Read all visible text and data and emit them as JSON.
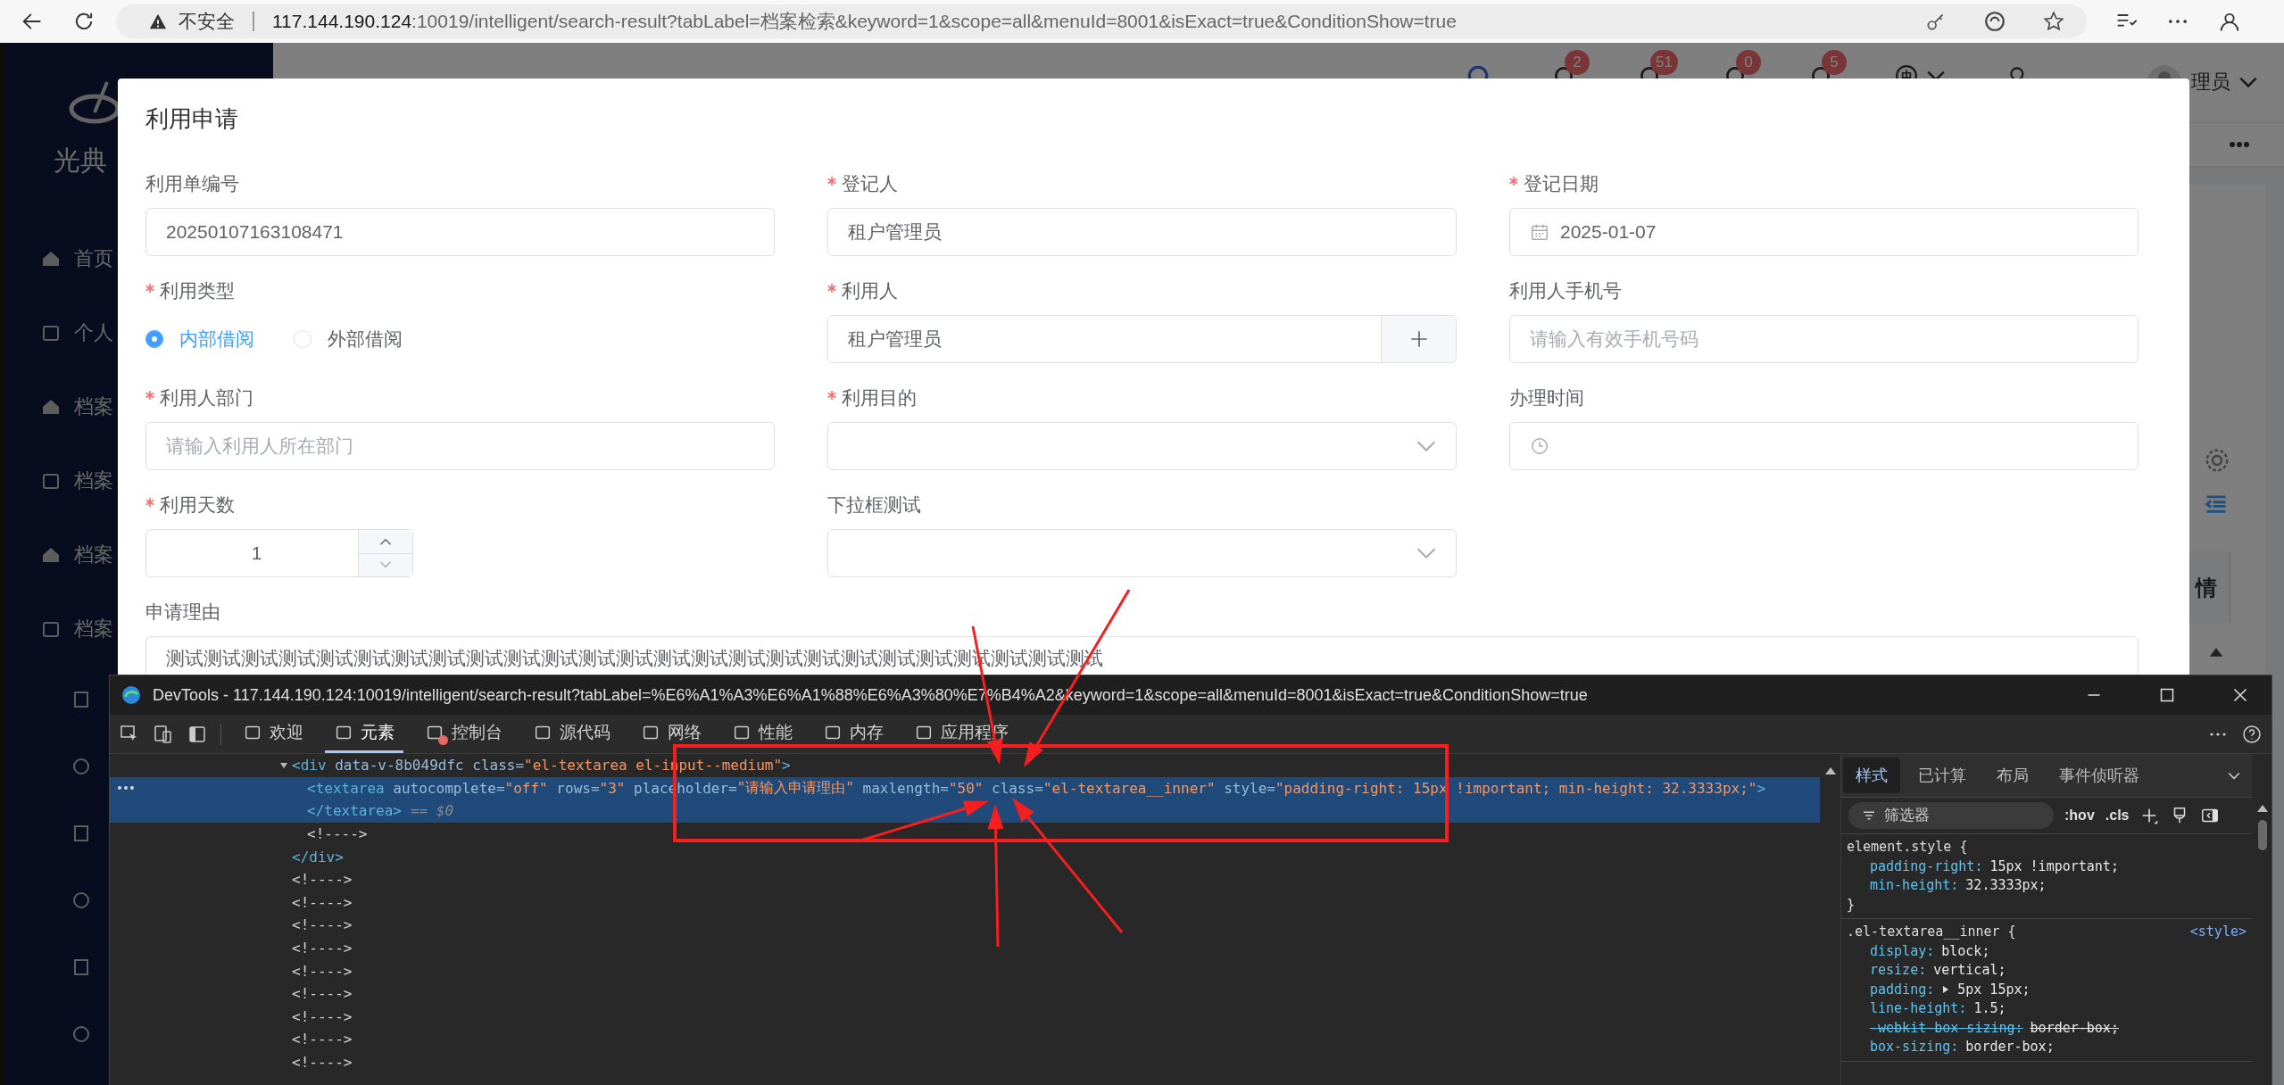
{
  "browser": {
    "security": "不安全",
    "url_host": "117.144.190.124",
    "url_rest": ":10019/intelligent/search-result?tabLabel=档案检索&keyword=1&scope=all&menuId=8001&isExact=true&ConditionShow=true"
  },
  "sidebar": {
    "brand": "光典",
    "items": [
      {
        "label": "首页"
      },
      {
        "label": "个人"
      },
      {
        "label": "档案"
      },
      {
        "label": "档案"
      },
      {
        "label": "档案"
      },
      {
        "label": "档案"
      }
    ]
  },
  "header": {
    "items": [
      {
        "badge": "2"
      },
      {
        "badge": "51"
      },
      {
        "badge": "0"
      },
      {
        "badge": "5"
      }
    ],
    "user": "理员"
  },
  "page": {
    "table_header": "情"
  },
  "dialog": {
    "title": "利用申请",
    "fields": [
      {
        "kind": "text",
        "label": "利用单编号",
        "required": false,
        "value": "20250107163108471"
      },
      {
        "kind": "text",
        "label": "登记人",
        "required": true,
        "value": "租户管理员"
      },
      {
        "kind": "date",
        "label": "登记日期",
        "required": true,
        "value": "2025-01-07"
      },
      {
        "kind": "radio",
        "label": "利用类型",
        "required": true,
        "options": [
          {
            "label": "内部借阅",
            "selected": true
          },
          {
            "label": "外部借阅",
            "selected": false
          }
        ]
      },
      {
        "kind": "picker",
        "label": "利用人",
        "required": true,
        "value": "租户管理员"
      },
      {
        "kind": "text",
        "label": "利用人手机号",
        "required": false,
        "placeholder": "请输入有效手机号码"
      },
      {
        "kind": "text",
        "label": "利用人部门",
        "required": true,
        "placeholder": "请输入利用人所在部门"
      },
      {
        "kind": "select",
        "label": "利用目的",
        "required": true
      },
      {
        "kind": "time",
        "label": "办理时间",
        "required": false
      },
      {
        "kind": "number",
        "label": "利用天数",
        "required": true,
        "value": "1"
      },
      {
        "kind": "select",
        "label": "下拉框测试",
        "required": false
      },
      {
        "kind": "textarea",
        "label": "申请理由",
        "required": false,
        "value": "测试测试测试测试测试测试测试测试测试测试测试测试测试测试测试测试测试测试测试测试测试测试测试测试测试"
      }
    ]
  },
  "devtools": {
    "title": "DevTools - 117.144.190.124:10019/intelligent/search-result?tabLabel=%E6%A1%A3%E6%A1%88%E6%A3%80%E7%B4%A2&keyword=1&scope=all&menuId=8001&isExact=true&ConditionShow=true",
    "tabs": [
      {
        "label": "欢迎",
        "selected": false,
        "alert": false
      },
      {
        "label": "元素",
        "selected": true,
        "alert": false
      },
      {
        "label": "控制台",
        "selected": false,
        "alert": true
      },
      {
        "label": "源代码",
        "selected": false,
        "alert": false
      },
      {
        "label": "网络",
        "selected": false,
        "alert": false
      },
      {
        "label": "性能",
        "selected": false,
        "alert": false
      },
      {
        "label": "内存",
        "selected": false,
        "alert": false
      },
      {
        "label": "应用程序",
        "selected": false,
        "alert": false
      }
    ],
    "nodes": [
      {
        "selected": false,
        "expanded": true,
        "open": [
          {
            "kind": "tag",
            "text": "<div"
          },
          {
            "kind": "attr",
            "text": " data-v-8b049dfc"
          },
          {
            "kind": "attr",
            "text": " class="
          },
          {
            "kind": "value",
            "text": "\"el-textarea el-input--medium\""
          },
          {
            "kind": "tag",
            "text": ">"
          }
        ],
        "children": [
          {
            "selected": true,
            "marker": "== $0",
            "open": [
              {
                "kind": "tag",
                "text": "<textarea"
              },
              {
                "kind": "attr",
                "text": " autocomplete="
              },
              {
                "kind": "value",
                "text": "\"off\""
              },
              {
                "kind": "attr",
                "text": " rows="
              },
              {
                "kind": "value",
                "text": "\"3\""
              },
              {
                "kind": "attr",
                "text": " placeholder="
              },
              {
                "kind": "value",
                "text": "\"请输入申请理由\""
              },
              {
                "kind": "attr",
                "text": " maxlength="
              },
              {
                "kind": "value",
                "text": "\"50\""
              },
              {
                "kind": "attr",
                "text": " class="
              },
              {
                "kind": "value",
                "text": "\"el-textarea__inner\""
              },
              {
                "kind": "attr",
                "text": " style="
              },
              {
                "kind": "value",
                "text": "\"padding-right: 15px !important; min-height: 32.3333px;\""
              },
              {
                "kind": "tag",
                "text": ">"
              }
            ],
            "close": [
              {
                "kind": "tag",
                "text": "</textarea>"
              }
            ]
          },
          {
            "selected": false,
            "open": [
              {
                "kind": "comment",
                "text": "<!---->"
              }
            ]
          }
        ],
        "close": [
          {
            "kind": "tag",
            "text": "</div>"
          }
        ]
      },
      {
        "selected": false,
        "open": [
          {
            "kind": "comment",
            "text": "<!---->"
          }
        ]
      },
      {
        "selected": false,
        "open": [
          {
            "kind": "comment",
            "text": "<!---->"
          }
        ]
      },
      {
        "selected": false,
        "open": [
          {
            "kind": "comment",
            "text": "<!---->"
          }
        ]
      },
      {
        "selected": false,
        "open": [
          {
            "kind": "comment",
            "text": "<!---->"
          }
        ]
      },
      {
        "selected": false,
        "open": [
          {
            "kind": "comment",
            "text": "<!---->"
          }
        ]
      },
      {
        "selected": false,
        "open": [
          {
            "kind": "comment",
            "text": "<!---->"
          }
        ]
      },
      {
        "selected": false,
        "open": [
          {
            "kind": "comment",
            "text": "<!---->"
          }
        ]
      },
      {
        "selected": false,
        "open": [
          {
            "kind": "comment",
            "text": "<!---->"
          }
        ]
      },
      {
        "selected": false,
        "open": [
          {
            "kind": "comment",
            "text": "<!---->"
          }
        ]
      }
    ],
    "styles": {
      "tabs": [
        {
          "label": "样式",
          "selected": true
        },
        {
          "label": "已计算",
          "selected": false
        },
        {
          "label": "布局",
          "selected": false
        },
        {
          "label": "事件侦听器",
          "selected": false
        }
      ],
      "filter_placeholder": "筛选器",
      "toggles": [
        ":hov",
        ".cls"
      ],
      "rules": [
        {
          "selector": "element.style {",
          "close": "}",
          "declarations": [
            {
              "name": "padding-right:",
              "value": "15px !important;",
              "struck": false,
              "expandable": false
            },
            {
              "name": "min-height:",
              "value": "32.3333px;",
              "struck": false,
              "expandable": false
            }
          ]
        },
        {
          "selector": ".el-textarea__inner {",
          "source": "<style>",
          "declarations": [
            {
              "name": "display:",
              "value": "block;",
              "struck": false,
              "expandable": false
            },
            {
              "name": "resize:",
              "value": "vertical;",
              "struck": false,
              "expandable": false
            },
            {
              "name": "padding:",
              "value": "5px 15px;",
              "struck": false,
              "expandable": true
            },
            {
              "name": "line-height:",
              "value": "1.5;",
              "struck": false,
              "expandable": false
            },
            {
              "name": "-webkit-box-sizing:",
              "value": "border-box;",
              "struck": true,
              "expandable": false
            },
            {
              "name": "box-sizing:",
              "value": "border-box;",
              "struck": false,
              "expandable": false
            }
          ]
        }
      ]
    }
  }
}
